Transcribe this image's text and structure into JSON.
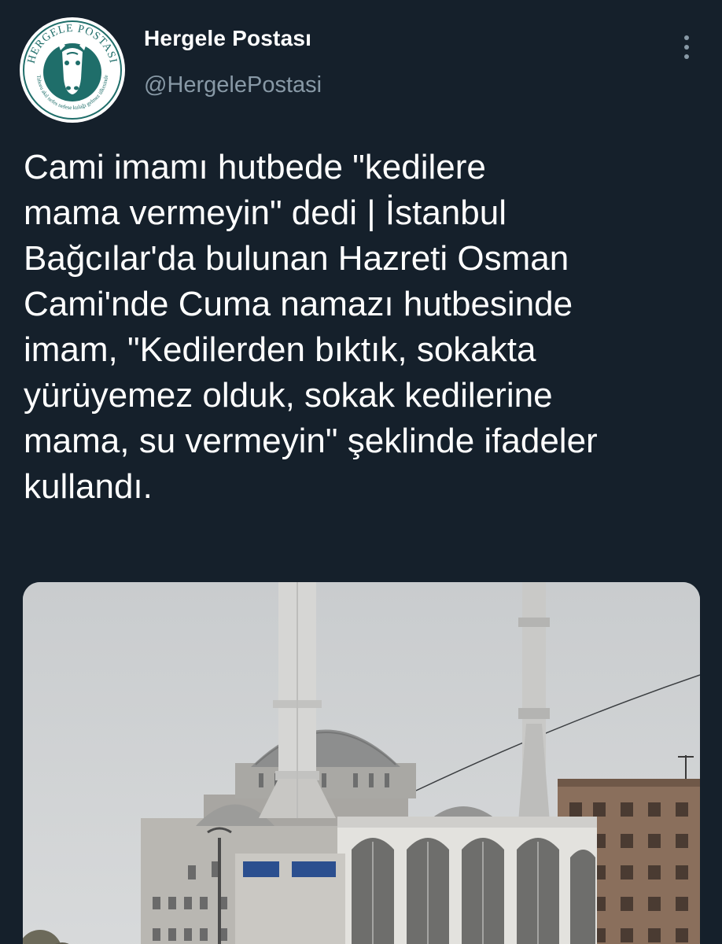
{
  "account": {
    "display_name": "Hergele Postası",
    "handle": "@HergelePostasi",
    "avatar_ring_text": "HERGELE POSTASI",
    "avatar_tagline": "Tahoru akıl nefes nefese kulağı gelmez ülkesinde"
  },
  "tweet": {
    "text": "Cami imamı hutbede \"kedilere\nmama vermeyin\" dedi | İstanbul\nBağcılar'da bulunan Hazreti Osman\nCami'nde Cuma namazı hutbesinde\nimam, \"Kedilerden bıktık, sokakta\nyürüyemez olduk, sokak kedilerine\nmama, su vermeyin\" şeklinde ifadeler\nkullandı."
  },
  "media": {
    "type": "photo",
    "subject": "mosque-with-minarets"
  },
  "icons": {
    "more": "more-vertical-icon",
    "avatar_logo": "donkey-icon"
  },
  "colors": {
    "background": "#15202b",
    "text_primary": "#ffffff",
    "text_secondary": "#8899a6",
    "avatar_teal": "#1f6e6a"
  }
}
